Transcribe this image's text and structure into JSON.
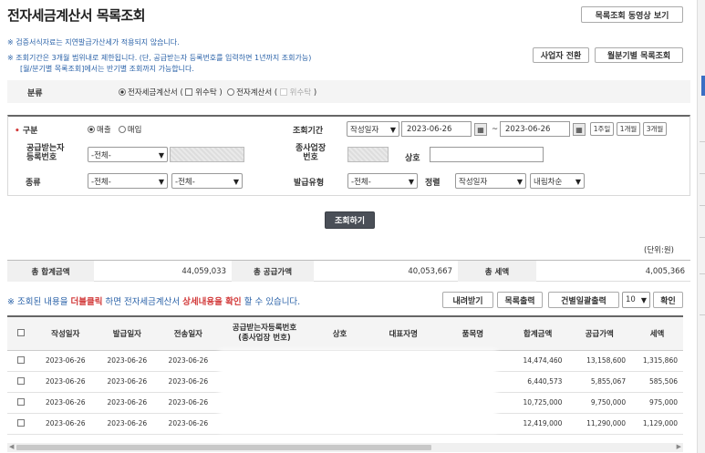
{
  "page": {
    "title": "전자세금계산서 목록조회",
    "video_button": "목록조회 동영상 보기",
    "notes": [
      "※ 검증서식자료는 지연발급가산세가 적용되지 않습니다.",
      "※ 조회기간은 3개월 범위내로 제한됩니다. (단, 공급받는자 등록번호를 입력하면 1년까지 조회가능)",
      "[월/분기별 목록조회]에서는 반기별 조회까지 가능합니다."
    ],
    "business_switch_button": "사업자 전환",
    "monthly_list_button": "월분기별 목록조회"
  },
  "category": {
    "label": "분류",
    "option_tax_invoice": "전자세금계산서",
    "open_paren": "(",
    "consign_label": "위수탁",
    "close_paren": ")",
    "option_invoice": "전자계산서"
  },
  "filter": {
    "type_label": "구분",
    "sales": "매출",
    "purchase": "매입",
    "period_label": "조회기간",
    "date_type": "작성일자",
    "start_date": "2023-06-26",
    "tilde": "~",
    "end_date": "2023-06-26",
    "btn_1week": "1주일",
    "btn_1month": "1개월",
    "btn_3month": "3개월",
    "receiver_reg_label_1": "공급받는자",
    "receiver_reg_label_2": "등록번호",
    "receiver_select": "-전체-",
    "branch_label_1": "종사업장",
    "branch_label_2": "번호",
    "company_label": "상호",
    "kind_label": "종류",
    "kind_select_1": "-전체-",
    "kind_select_2": "-전체-",
    "issue_type_label": "발급유형",
    "issue_type_select": "-전체-",
    "sort_label": "정렬",
    "sort_select": "작성일자",
    "order_select": "내림차순",
    "search_button": "조회하기"
  },
  "summary": {
    "unit": "(단위:원)",
    "total_label": "총 합계금액",
    "total_value": "44,059,033",
    "supply_label": "총 공급가액",
    "supply_value": "40,053,667",
    "tax_label": "총 세액",
    "tax_value": "4,005,366"
  },
  "info": {
    "prefix": "※ 조회된 내용을 ",
    "dbl": "더블클릭",
    "mid": " 하면 전자세금계산서 ",
    "detail": "상세내용을 확인",
    "suffix": " 할 수 있습니다."
  },
  "toolbar": {
    "download": "내려받기",
    "print_list": "목록출력",
    "bulk_print": "건별일괄출력",
    "page_size": "10",
    "confirm": "확인"
  },
  "table": {
    "headers": {
      "written": "작성일자",
      "issued": "발급일자",
      "sent": "전송일자",
      "receiver_1": "공급받는자등록번호",
      "receiver_2": "(종사업장 번호)",
      "company": "상호",
      "ceo": "대표자명",
      "item": "품목명",
      "total": "합계금액",
      "supply": "공급가액",
      "tax": "세액"
    },
    "rows": [
      {
        "written": "2023-06-26",
        "issued": "2023-06-26",
        "sent": "2023-06-26",
        "total": "14,474,460",
        "supply": "13,158,600",
        "tax": "1,315,860"
      },
      {
        "written": "2023-06-26",
        "issued": "2023-06-26",
        "sent": "2023-06-26",
        "total": "6,440,573",
        "supply": "5,855,067",
        "tax": "585,506"
      },
      {
        "written": "2023-06-26",
        "issued": "2023-06-26",
        "sent": "2023-06-26",
        "total": "10,725,000",
        "supply": "9,750,000",
        "tax": "975,000"
      },
      {
        "written": "2023-06-26",
        "issued": "2023-06-26",
        "sent": "2023-06-26",
        "total": "12,419,000",
        "supply": "11,290,000",
        "tax": "1,129,000"
      }
    ]
  },
  "colors": {
    "accent_blue": "#2a62a8",
    "emphasis_red": "#d23a3a",
    "search_button_bg": "#4a4f57"
  }
}
